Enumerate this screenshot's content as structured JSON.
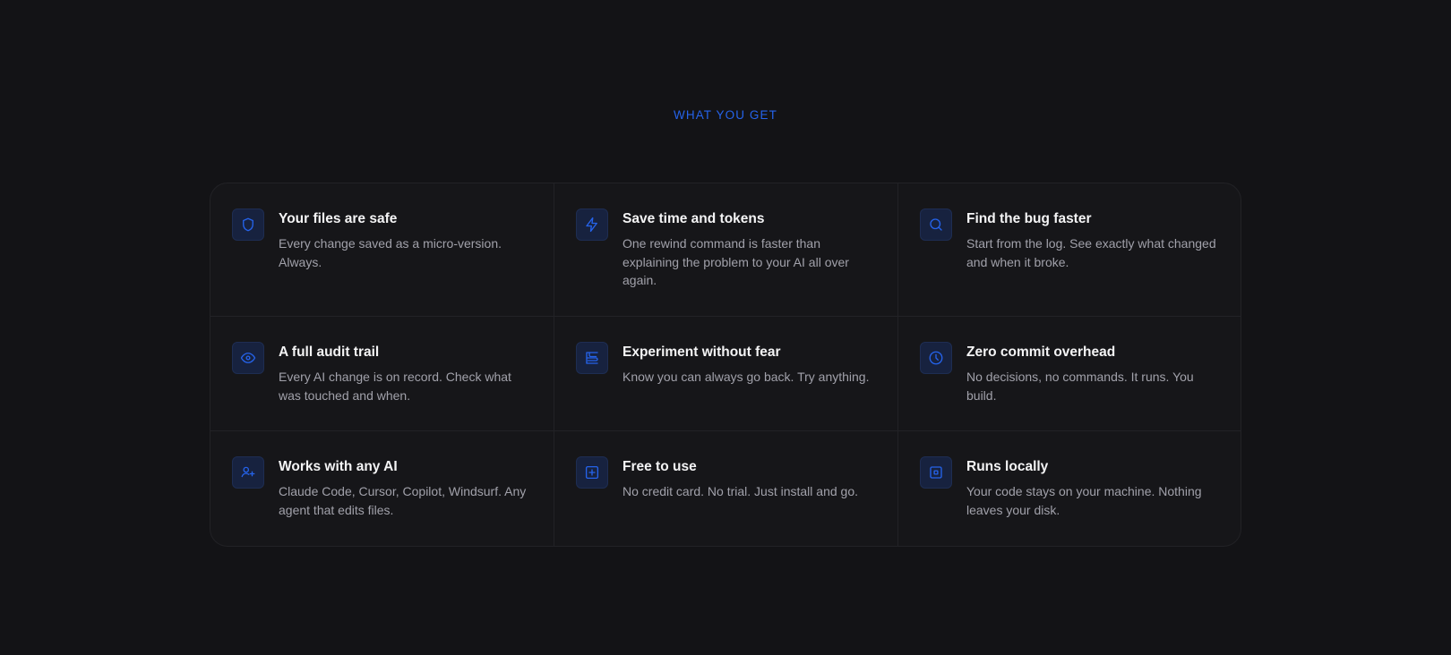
{
  "section": {
    "eyebrow": "WHAT YOU GET",
    "accent_color": "#2563eb"
  },
  "features": [
    {
      "icon": "shield-icon",
      "title": "Your files are safe",
      "desc": "Every change saved as a micro-version. Always."
    },
    {
      "icon": "zap-icon",
      "title": "Save time and tokens",
      "desc": "One rewind command is faster than explaining the problem to your AI all over again."
    },
    {
      "icon": "search-icon",
      "title": "Find the bug faster",
      "desc": "Start from the log. See exactly what changed and when it broke."
    },
    {
      "icon": "eye-icon",
      "title": "A full audit trail",
      "desc": "Every AI change is on record. Check what was touched and when."
    },
    {
      "icon": "layout-icon",
      "title": "Experiment without fear",
      "desc": "Know you can always go back. Try anything."
    },
    {
      "icon": "clock-icon",
      "title": "Zero commit overhead",
      "desc": "No decisions, no commands. It runs. You build."
    },
    {
      "icon": "user-plus-icon",
      "title": "Works with any AI",
      "desc": "Claude Code, Cursor, Copilot, Windsurf. Any agent that edits files."
    },
    {
      "icon": "plus-square-icon",
      "title": "Free to use",
      "desc": "No credit card. No trial. Just install and go."
    },
    {
      "icon": "square-dot-icon",
      "title": "Runs locally",
      "desc": "Your code stays on your machine. Nothing leaves your disk."
    }
  ]
}
